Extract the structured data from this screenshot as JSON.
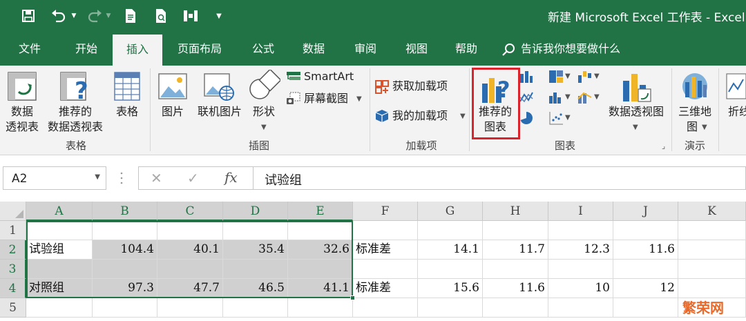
{
  "app": {
    "title": "新建 Microsoft Excel 工作表 - Excel",
    "colors": {
      "brand": "#217346",
      "highlight": "#d9232d",
      "selection": "#217346"
    }
  },
  "quick_access": [
    {
      "icon": "save-icon"
    },
    {
      "icon": "undo-icon"
    },
    {
      "icon": "redo-icon"
    },
    {
      "icon": "new-document-icon"
    },
    {
      "icon": "print-preview-icon"
    },
    {
      "icon": "touch-mode-icon"
    },
    {
      "icon": "customize-toolbar-icon"
    }
  ],
  "tabs": [
    "文件",
    "开始",
    "插入",
    "页面布局",
    "公式",
    "数据",
    "审阅",
    "视图",
    "帮助"
  ],
  "active_tab": "插入",
  "tell_me": "告诉我你想要做什么",
  "ribbon": {
    "pivot_table": {
      "line1": "数据",
      "line2": "透视表"
    },
    "recommended_pivot": {
      "line1": "推荐的",
      "line2": "数据透视表"
    },
    "table": "表格",
    "group_tables": "表格",
    "picture": "图片",
    "online_picture": "联机图片",
    "shapes": "形状",
    "smartart": "SmartArt",
    "screenshot": "屏幕截图",
    "group_illustrations": "插图",
    "get_addins": "获取加载项",
    "my_addins": "我的加载项",
    "group_addins": "加载项",
    "recommended_charts": {
      "line1": "推荐的",
      "line2": "图表"
    },
    "pivot_chart": "数据透视图",
    "group_charts": "图表",
    "map_3d": {
      "line1": "三维地",
      "line2": "图"
    },
    "group_tours": "演示",
    "sparkline_line": "折线"
  },
  "formula_bar": {
    "name_box": "A2",
    "cancel_glyph": "✕",
    "enter_glyph": "✓",
    "fx": "fx",
    "content": "试验组"
  },
  "sheet": {
    "columns": [
      "A",
      "B",
      "C",
      "D",
      "E",
      "F",
      "G",
      "H",
      "I",
      "J",
      "K"
    ],
    "rows": [
      "1",
      "2",
      "3",
      "4",
      "5"
    ],
    "selected_range": "A2:E4",
    "cells": {
      "A2": "试验组",
      "B2": "104.4",
      "C2": "40.1",
      "D2": "35.4",
      "E2": "32.6",
      "F2": "标准差",
      "G2": "14.1",
      "H2": "11.7",
      "I2": "12.3",
      "J2": "11.6",
      "A4": "对照组",
      "B4": "97.3",
      "C4": "47.7",
      "D4": "46.5",
      "E4": "41.1",
      "F4": "标准差",
      "G4": "15.6",
      "H4": "11.6",
      "I4": "10",
      "J4": "12"
    }
  },
  "watermark": "繁荣网"
}
